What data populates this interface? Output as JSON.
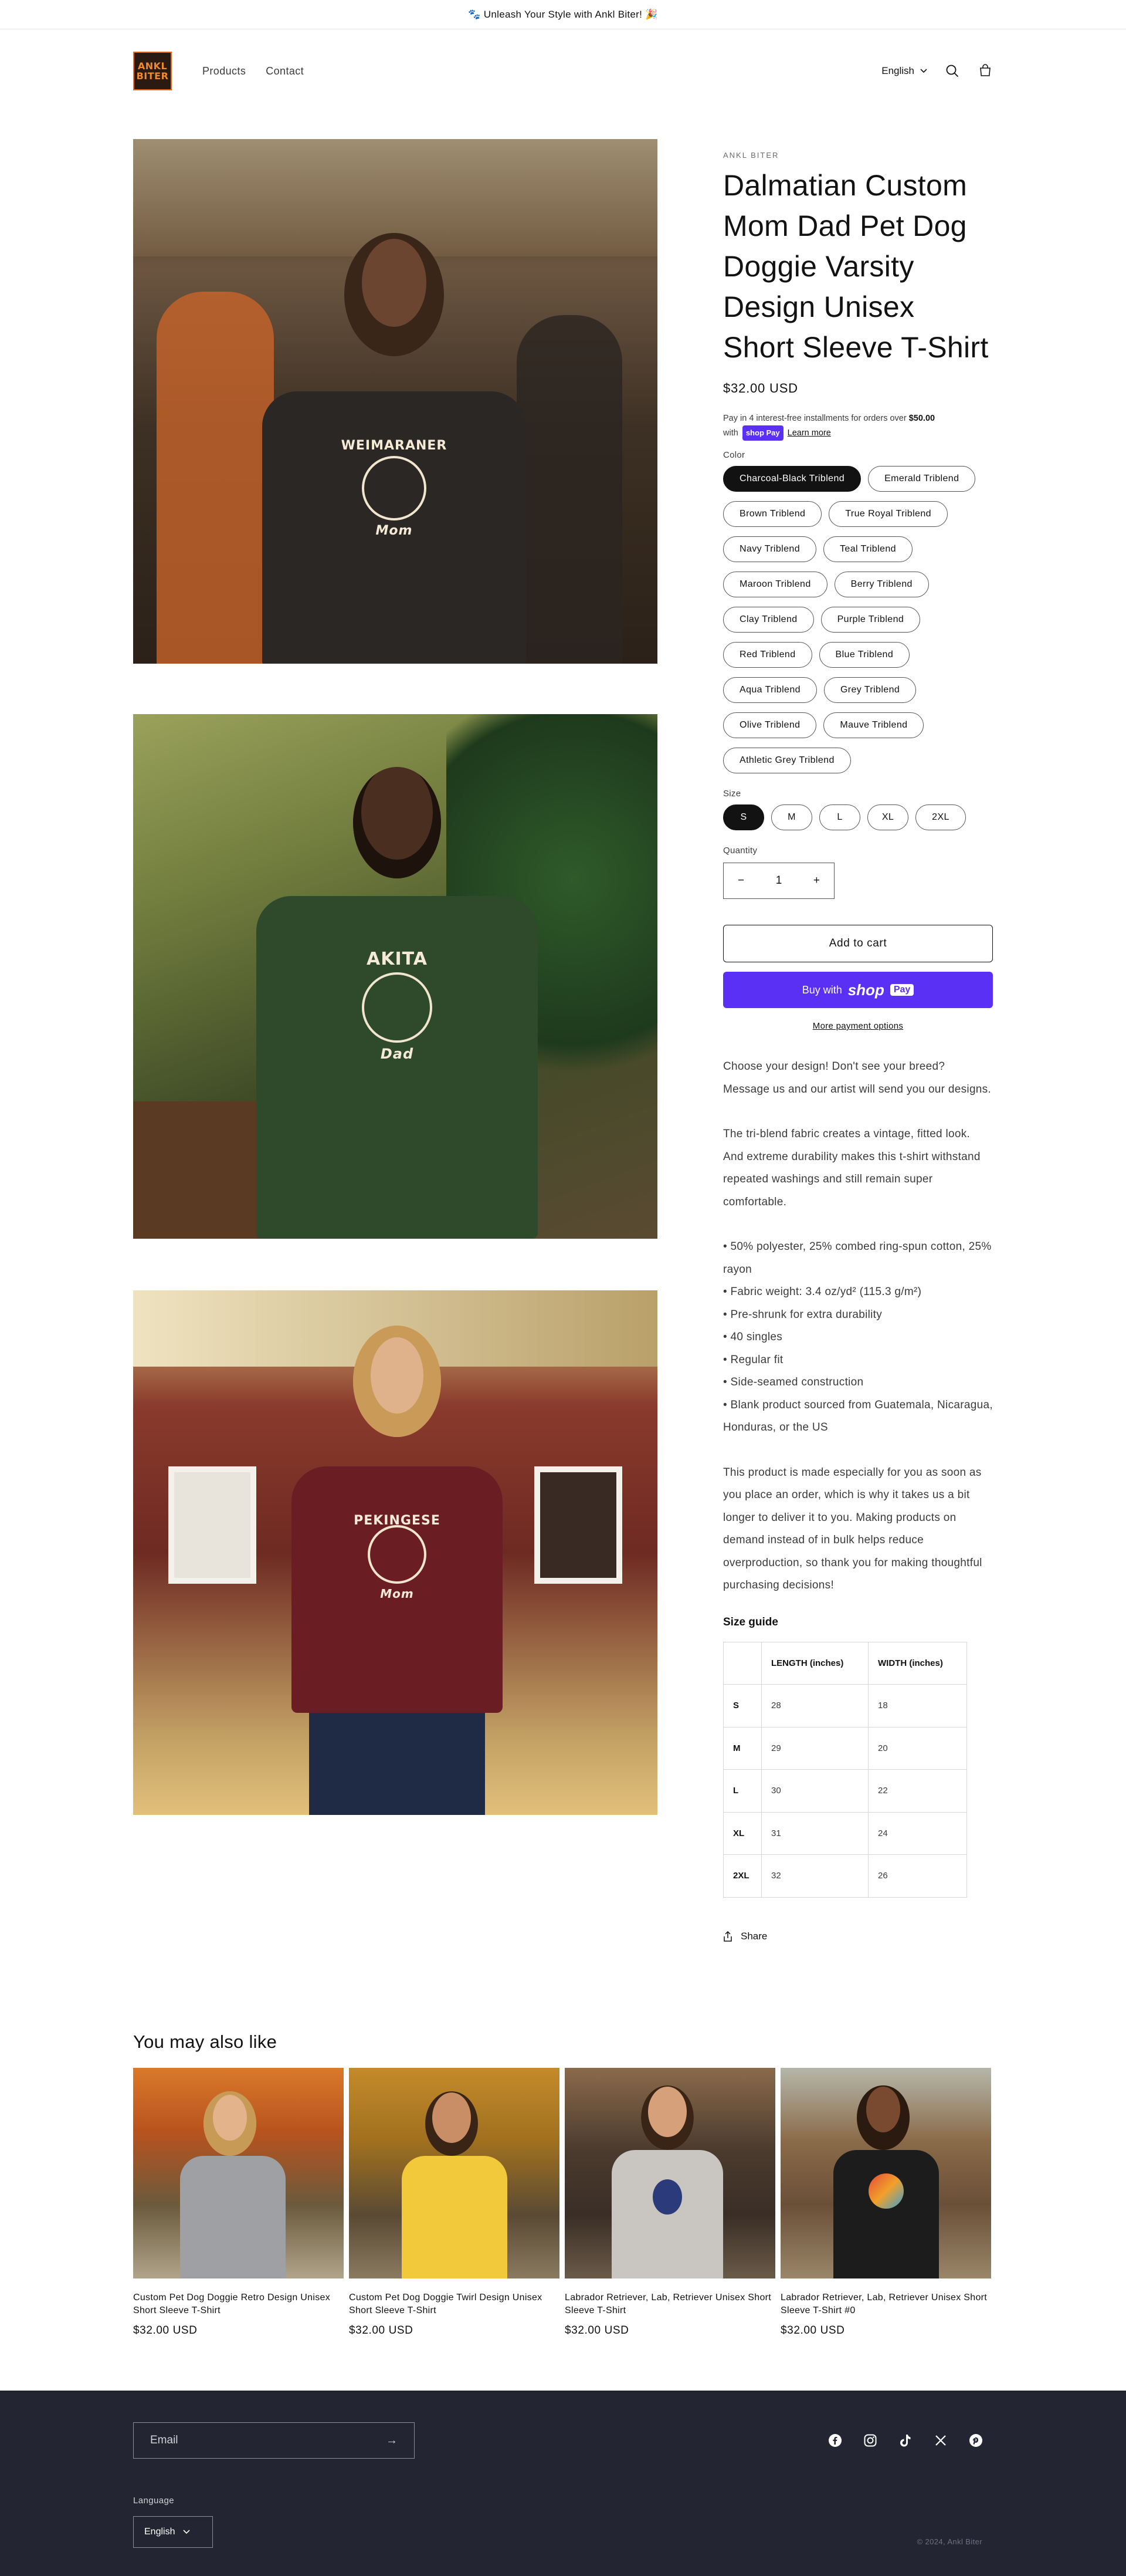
{
  "announcement": "🐾 Unleash Your Style with Ankl Biter! 🎉",
  "header": {
    "logo_text_1": "ANKL",
    "logo_text_2": "BITER",
    "nav": [
      "Products",
      "Contact"
    ],
    "language": "English"
  },
  "gallery": [
    {
      "emblem_text": "WEIMARANER",
      "sub": "Mom"
    },
    {
      "emblem_text": "AKITA",
      "sub": "Dad"
    },
    {
      "emblem_text": "PEKINGESE",
      "sub": "Mom"
    }
  ],
  "product": {
    "vendor": "ANKL BITER",
    "title": "Dalmatian Custom Mom Dad Pet Dog Doggie Varsity Design Unisex Short Sleeve T-Shirt",
    "price": "$32.00 USD",
    "installments_pre": "Pay in 4 interest-free installments for orders over ",
    "installments_amount": "$50.00",
    "installments_with": "with",
    "shop_badge": "shop Pay",
    "learn_more": "Learn more",
    "color_label": "Color",
    "colors": [
      "Charcoal-Black Triblend",
      "Emerald Triblend",
      "Brown Triblend",
      "True Royal Triblend",
      "Navy Triblend",
      "Teal Triblend",
      "Maroon Triblend",
      "Berry Triblend",
      "Clay Triblend",
      "Purple Triblend",
      "Red Triblend",
      "Blue Triblend",
      "Aqua Triblend",
      "Grey Triblend",
      "Olive Triblend",
      "Mauve Triblend",
      "Athletic Grey Triblend"
    ],
    "selected_color": "Charcoal-Black Triblend",
    "size_label": "Size",
    "sizes": [
      "S",
      "M",
      "L",
      "XL",
      "2XL"
    ],
    "selected_size": "S",
    "quantity_label": "Quantity",
    "quantity": "1",
    "add_to_cart": "Add to cart",
    "buy_with": "Buy with",
    "shop_logo": "shop",
    "pay_badge": "Pay",
    "more_payment": "More payment options",
    "description": {
      "p1": "Choose your design! Don't see your breed? Message us and our artist will send you our designs.",
      "p2": "The tri-blend fabric creates a vintage, fitted look. And extreme durability makes this t-shirt withstand repeated washings and still remain super comfortable.",
      "bullets": [
        "• 50% polyester, 25% combed ring-spun cotton, 25% rayon",
        "• Fabric weight: 3.4 oz/yd² (115.3 g/m²)",
        "• Pre-shrunk for extra durability",
        "• 40 singles",
        "• Regular fit",
        "• Side-seamed construction",
        "• Blank product sourced from Guatemala, Nicaragua, Honduras, or the US"
      ],
      "p3": "This product is made especially for you as soon as you place an order, which is why it takes us a bit longer to deliver it to you. Making products on demand instead of in bulk helps reduce overproduction, so thank you for making thoughtful purchasing decisions!"
    },
    "size_guide_title": "Size guide",
    "size_table": {
      "headers": [
        "",
        "LENGTH (inches)",
        "WIDTH (inches)"
      ],
      "rows": [
        [
          "S",
          "28",
          "18"
        ],
        [
          "M",
          "29",
          "20"
        ],
        [
          "L",
          "30",
          "22"
        ],
        [
          "XL",
          "31",
          "24"
        ],
        [
          "2XL",
          "32",
          "26"
        ]
      ]
    },
    "share": "Share"
  },
  "recommendations": {
    "title": "You may also like",
    "items": [
      {
        "title": "Custom Pet Dog Doggie Retro Design Unisex Short Sleeve T-Shirt",
        "price": "$32.00 USD"
      },
      {
        "title": "Custom Pet Dog Doggie Twirl Design Unisex Short Sleeve T-Shirt",
        "price": "$32.00 USD"
      },
      {
        "title": "Labrador Retriever, Lab, Retriever Unisex Short Sleeve T-Shirt",
        "price": "$32.00 USD"
      },
      {
        "title": "Labrador Retriever, Lab, Retriever Unisex Short Sleeve T-Shirt #0",
        "price": "$32.00 USD"
      }
    ]
  },
  "footer": {
    "email_placeholder": "Email",
    "language_label": "Language",
    "language": "English",
    "copyright": "© 2024, Ankl Biter",
    "socials": [
      "facebook-icon",
      "instagram-icon",
      "tiktok-icon",
      "x-icon",
      "pinterest-icon"
    ]
  },
  "colors": {
    "accent": "#5a31f4",
    "footer_bg": "#232533",
    "text": "#121212"
  }
}
